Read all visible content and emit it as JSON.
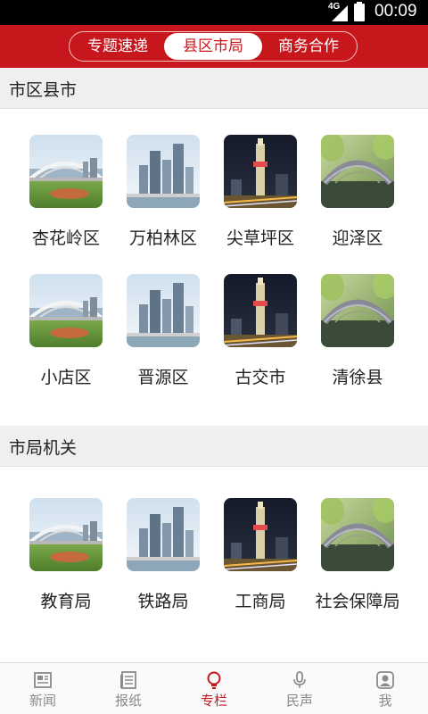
{
  "status_bar": {
    "network": "4G",
    "time": "00:09"
  },
  "segmented_tabs": [
    {
      "label": "专题速递",
      "active": false
    },
    {
      "label": "县区市局",
      "active": true
    },
    {
      "label": "商务合作",
      "active": false
    }
  ],
  "sections": [
    {
      "title": "市区县市",
      "items": [
        {
          "label": "杏花岭区",
          "image": "bridge-photo"
        },
        {
          "label": "万柏林区",
          "image": "skyscrapers-photo"
        },
        {
          "label": "尖草坪区",
          "image": "night-tower-photo"
        },
        {
          "label": "迎泽区",
          "image": "arch-bridge-photo"
        },
        {
          "label": "小店区",
          "image": "bridge-photo"
        },
        {
          "label": "晋源区",
          "image": "skyscrapers-photo"
        },
        {
          "label": "古交市",
          "image": "night-tower-photo"
        },
        {
          "label": "清徐县",
          "image": "arch-bridge-photo"
        }
      ]
    },
    {
      "title": "市局机关",
      "items": [
        {
          "label": "教育局",
          "image": "bridge-photo"
        },
        {
          "label": "铁路局",
          "image": "skyscrapers-photo"
        },
        {
          "label": "工商局",
          "image": "night-tower-photo"
        },
        {
          "label": "社会保障局",
          "image": "arch-bridge-photo"
        }
      ]
    }
  ],
  "bottom_nav": [
    {
      "label": "新闻",
      "icon": "newspaper-icon",
      "active": false
    },
    {
      "label": "报纸",
      "icon": "paper-icon",
      "active": false
    },
    {
      "label": "专栏",
      "icon": "lightbulb-icon",
      "active": true
    },
    {
      "label": "民声",
      "icon": "microphone-icon",
      "active": false
    },
    {
      "label": "我",
      "icon": "user-icon",
      "active": false
    }
  ],
  "colors": {
    "brand_red": "#c8161d",
    "section_bg": "#efefef",
    "nav_inactive": "#8a8a8a"
  }
}
